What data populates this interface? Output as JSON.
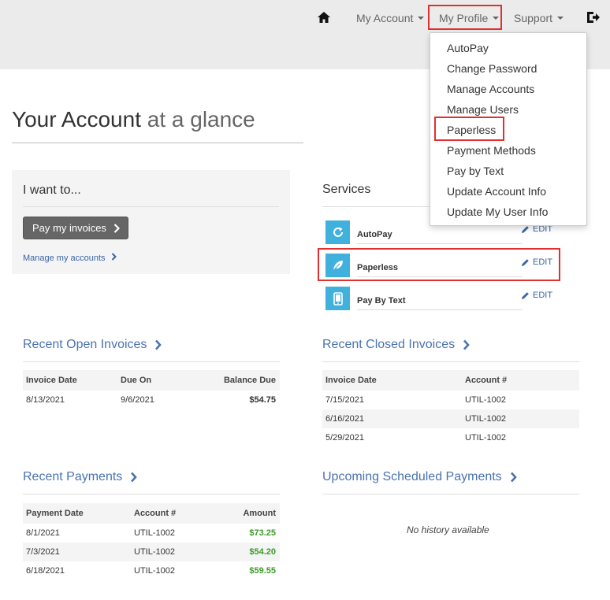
{
  "nav": {
    "my_account": "My Account",
    "my_profile": "My Profile",
    "support": "Support"
  },
  "profile_menu": {
    "items": [
      "AutoPay",
      "Change Password",
      "Manage Accounts",
      "Manage Users",
      "Paperless",
      "Payment Methods",
      "Pay by Text",
      "Update Account Info",
      "Update My User Info"
    ]
  },
  "page": {
    "title_main": "Your Account",
    "title_soft": "at a glance"
  },
  "want": {
    "title": "I want to...",
    "pay_button": "Pay my invoices",
    "manage_link": "Manage my accounts"
  },
  "services": {
    "title": "Services",
    "edit_label": "EDIT",
    "items": [
      "AutoPay",
      "Paperless",
      "Pay By Text"
    ]
  },
  "open_invoices": {
    "title": "Recent Open Invoices",
    "headers": [
      "Invoice Date",
      "Due On",
      "Balance Due"
    ],
    "rows": [
      [
        "8/13/2021",
        "9/6/2021",
        "$54.75"
      ]
    ]
  },
  "closed_invoices": {
    "title": "Recent Closed Invoices",
    "headers": [
      "Invoice Date",
      "Account #"
    ],
    "rows": [
      [
        "7/15/2021",
        "UTIL-1002"
      ],
      [
        "6/16/2021",
        "UTIL-1002"
      ],
      [
        "5/29/2021",
        "UTIL-1002"
      ]
    ]
  },
  "payments": {
    "title": "Recent Payments",
    "headers": [
      "Payment Date",
      "Account #",
      "Amount"
    ],
    "rows": [
      [
        "8/1/2021",
        "UTIL-1002",
        "$73.25"
      ],
      [
        "7/3/2021",
        "UTIL-1002",
        "$54.20"
      ],
      [
        "6/18/2021",
        "UTIL-1002",
        "$59.55"
      ]
    ]
  },
  "scheduled": {
    "title": "Upcoming Scheduled Payments",
    "empty": "No history available"
  },
  "colors": {
    "accent_blue": "#4a72b0",
    "service_icon": "#3fb1dc",
    "highlight": "#e03030",
    "amount_green": "#3c9a2a"
  }
}
